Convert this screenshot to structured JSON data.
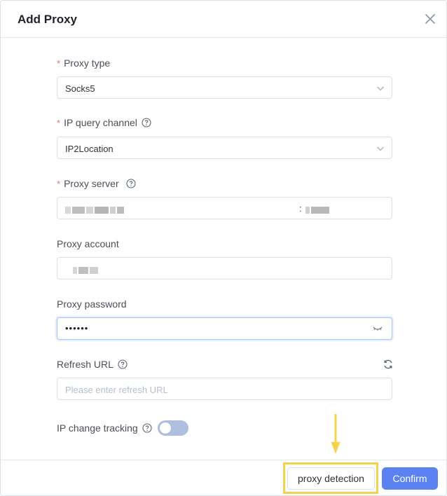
{
  "dialog": {
    "title": "Add Proxy"
  },
  "form": {
    "proxy_type": {
      "label": "Proxy type",
      "required_mark": "*",
      "value": "Socks5"
    },
    "ip_query_channel": {
      "label": "IP query channel",
      "required_mark": "*",
      "value": "IP2Location"
    },
    "proxy_server": {
      "label": "Proxy server",
      "required_mark": "*",
      "host_value_redacted": true,
      "separator": ":",
      "port_value_redacted": true
    },
    "proxy_account": {
      "label": "Proxy account",
      "value_redacted": true
    },
    "proxy_password": {
      "label": "Proxy password",
      "masked_value": "••••••"
    },
    "refresh_url": {
      "label": "Refresh URL",
      "placeholder": "Please enter refresh URL",
      "value": ""
    },
    "ip_change_tracking": {
      "label": "IP change tracking",
      "enabled": false
    }
  },
  "footer": {
    "detect_label": "proxy detection",
    "confirm_label": "Confirm"
  },
  "colors": {
    "required": "#f56c6c",
    "primary": "#5b82f0",
    "highlight": "#f4d24b",
    "toggle_off": "#aebfe0"
  },
  "icons": {
    "close": "close-icon",
    "help": "question-circle-icon",
    "chevron": "chevron-down-icon",
    "eye": "eye-closed-icon",
    "refresh": "refresh-icon",
    "arrow": "arrow-down-icon"
  }
}
